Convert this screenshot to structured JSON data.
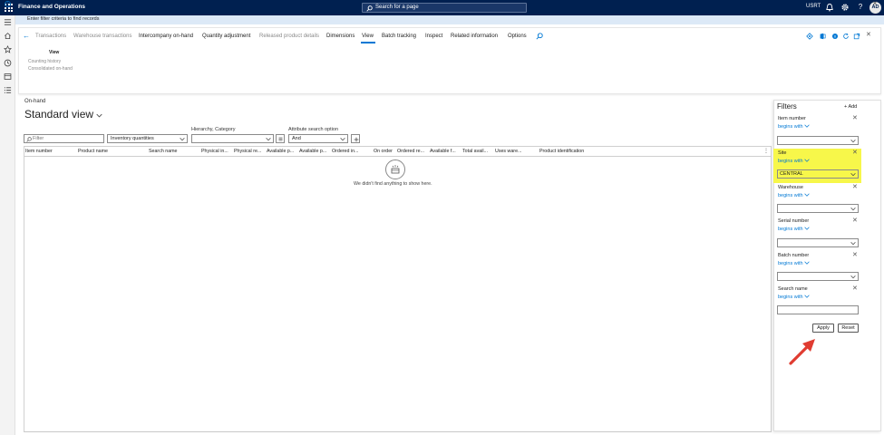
{
  "topbar": {
    "app_title": "Finance and Operations",
    "search_placeholder": "Search for a page",
    "company": "USRT",
    "avatar_initials": "AD"
  },
  "infobar": {
    "message": "Enter filter criteria to find records"
  },
  "action_pane": {
    "tabs": [
      {
        "label": "Transactions",
        "state": "disabled"
      },
      {
        "label": "Warehouse transactions",
        "state": "disabled"
      },
      {
        "label": "Intercompany on-hand",
        "state": "enabled"
      },
      {
        "label": "Quantity adjustment",
        "state": "enabled"
      },
      {
        "label": "Released product details",
        "state": "disabled"
      },
      {
        "label": "Dimensions",
        "state": "enabled"
      },
      {
        "label": "View",
        "state": "selected"
      },
      {
        "label": "Batch tracking",
        "state": "enabled"
      },
      {
        "label": "Inspect",
        "state": "enabled"
      },
      {
        "label": "Related information",
        "state": "enabled"
      },
      {
        "label": "Options",
        "state": "enabled"
      }
    ],
    "group_title": "View",
    "group_items": [
      "Counting history",
      "Consolidated on-hand"
    ]
  },
  "page": {
    "breadcrumb": "On-hand",
    "title": "Standard view",
    "filter_placeholder": "Filter",
    "inventory_dropdown": "Inventory quantities",
    "hierarchy_label": "Hierarchy, Category",
    "hierarchy_value": "",
    "attr_label": "Attribute search option",
    "attr_value": "And"
  },
  "grid": {
    "columns": [
      "Item number",
      "Product name",
      "Search name",
      "Physical in...",
      "Physical re...",
      "Available p...",
      "Available p...",
      "Ordered in...",
      "On order",
      "Ordered re...",
      "Available f...",
      "Total avail...",
      "Uses ware...",
      "Product identification"
    ],
    "empty_message": "We didn't find anything to show here."
  },
  "filters": {
    "title": "Filters",
    "add_label": "Add",
    "fields": [
      {
        "label": "Item number",
        "operator": "begins with",
        "value": ""
      },
      {
        "label": "Site",
        "operator": "begins with",
        "value": "CENTRAL",
        "highlighted": true
      },
      {
        "label": "Warehouse",
        "operator": "begins with",
        "value": ""
      },
      {
        "label": "Serial number",
        "operator": "begins with",
        "value": ""
      },
      {
        "label": "Batch number",
        "operator": "begins with",
        "value": ""
      },
      {
        "label": "Search name",
        "operator": "begins with",
        "value": ""
      }
    ],
    "apply_label": "Apply",
    "reset_label": "Reset"
  },
  "colors": {
    "topbar": "#002050",
    "accent": "#0078d4",
    "highlight": "#f7f74a",
    "annotation_arrow": "#e03c31"
  }
}
